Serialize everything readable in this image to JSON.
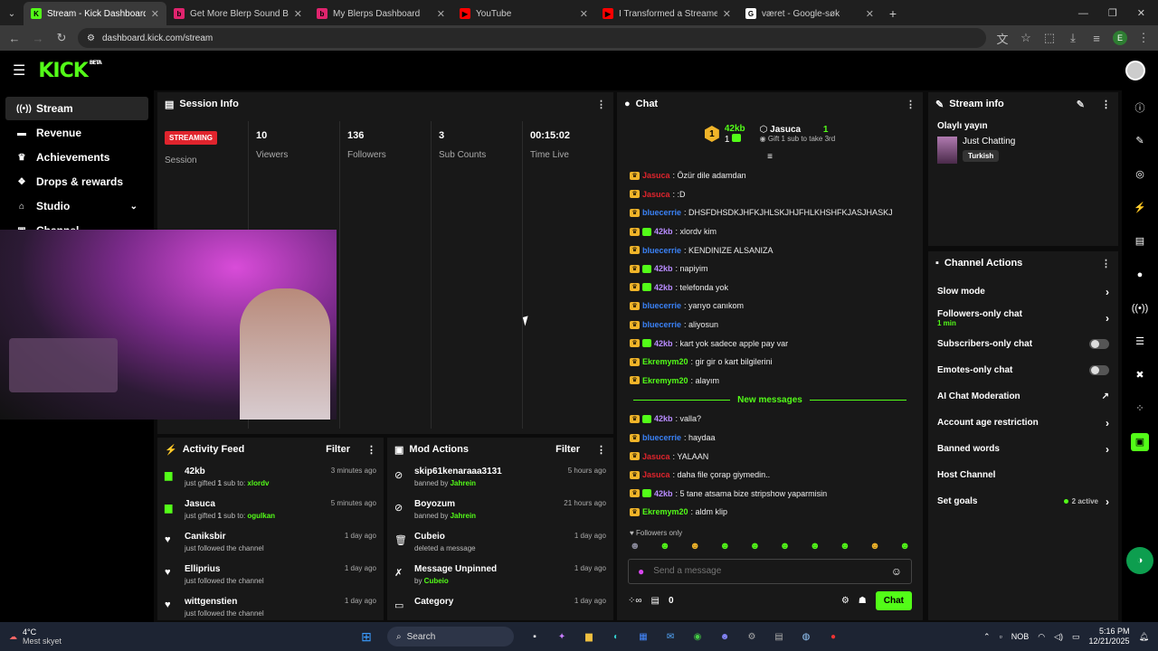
{
  "browser": {
    "tabs": [
      {
        "title": "Stream - Kick Dashboard",
        "color": "#53fc18",
        "glyph": "K"
      },
      {
        "title": "Get More Blerp Sound Beets!",
        "color": "#e0246e",
        "glyph": "b"
      },
      {
        "title": "My Blerps Dashboard",
        "color": "#e0246e",
        "glyph": "b"
      },
      {
        "title": "YouTube",
        "color": "#ff0000",
        "glyph": "▶"
      },
      {
        "title": "I Transformed a Streamer's Life",
        "color": "#ff0000",
        "glyph": "▶"
      },
      {
        "title": "været - Google-søk",
        "color": "#ffffff",
        "glyph": "G"
      }
    ],
    "url": "dashboard.kick.com/stream",
    "profile_initial": "E"
  },
  "brand": {
    "logo": "KICK",
    "beta": "BETA"
  },
  "sidebar": {
    "items": [
      {
        "label": "Stream",
        "icon": "broadcast-icon"
      },
      {
        "label": "Revenue",
        "icon": "revenue-icon"
      },
      {
        "label": "Achievements",
        "icon": "trophy-icon"
      },
      {
        "label": "Drops & rewards",
        "icon": "gift-icon"
      },
      {
        "label": "Studio",
        "icon": "studio-icon"
      },
      {
        "label": "Channel",
        "icon": "channel-icon"
      }
    ]
  },
  "session": {
    "title": "Session Info",
    "status": "STREAMING",
    "session_label": "Session",
    "stats": [
      {
        "value": "10",
        "label": "Viewers"
      },
      {
        "value": "136",
        "label": "Followers"
      },
      {
        "value": "3",
        "label": "Sub Counts"
      },
      {
        "value": "00:15:02",
        "label": "Time Live"
      }
    ]
  },
  "activity": {
    "title": "Activity Feed",
    "filter": "Filter",
    "items": [
      {
        "name": "42kb",
        "pre": "just gifted ",
        "count": "1",
        "mid": " sub to: ",
        "target": "xlordv",
        "time": "3 minutes ago",
        "icon": "gift-icon"
      },
      {
        "name": "Jasuca",
        "pre": "just gifted ",
        "count": "1",
        "mid": " sub to: ",
        "target": "ogulkan",
        "time": "5 minutes ago",
        "icon": "gift-icon"
      },
      {
        "name": "Caniksbir",
        "pre": "just followed the channel",
        "count": "",
        "mid": "",
        "target": "",
        "time": "1 day ago",
        "icon": "heart-icon"
      },
      {
        "name": "Elliprius",
        "pre": "just followed the channel",
        "count": "",
        "mid": "",
        "target": "",
        "time": "1 day ago",
        "icon": "heart-icon"
      },
      {
        "name": "wittgenstien",
        "pre": "just followed the channel",
        "count": "",
        "mid": "",
        "target": "",
        "time": "1 day ago",
        "icon": "heart-icon"
      }
    ]
  },
  "mod": {
    "title": "Mod Actions",
    "filter": "Filter",
    "items": [
      {
        "name": "skip61kenaraaa3131",
        "pre": "banned by ",
        "by": "Jahrein",
        "time": "5 hours ago",
        "icon": "ban-icon"
      },
      {
        "name": "Boyozum",
        "pre": "banned by ",
        "by": "Jahrein",
        "time": "21 hours ago",
        "icon": "ban-icon"
      },
      {
        "name": "Cubeio",
        "pre": "deleted a message",
        "by": "",
        "time": "1 day ago",
        "icon": "trash-icon"
      },
      {
        "name": "Message Unpinned",
        "pre": "by ",
        "by": "Cubeio",
        "time": "1 day ago",
        "icon": "unpin-icon"
      },
      {
        "name": "Category",
        "pre": "",
        "by": "",
        "time": "1 day ago",
        "icon": "category-icon"
      }
    ]
  },
  "chat": {
    "title": "Chat",
    "leader": {
      "rank": "1",
      "name1": "42kb",
      "count1": "1",
      "name2": "Jasuca",
      "count2": "1",
      "gift_text": "Gift 1 sub to take 3rd"
    },
    "messages": [
      {
        "user": "Jasuca",
        "cls": "u-red",
        "gift": false,
        "text": ": Özür dile adamdan"
      },
      {
        "user": "Jasuca",
        "cls": "u-red",
        "gift": false,
        "text": ": :D"
      },
      {
        "user": "bluecerrie",
        "cls": "u-blue",
        "gift": false,
        "text": ": DHSFDHSDKJHFKJHLSKJHJFHLKHSHFKJASJHASKJ"
      },
      {
        "user": "42kb",
        "cls": "u-purple",
        "gift": true,
        "text": ": xlordv kim"
      },
      {
        "user": "bluecerrie",
        "cls": "u-blue",
        "gift": false,
        "text": ": KENDINIZE ALSANIZA"
      },
      {
        "user": "42kb",
        "cls": "u-purple",
        "gift": true,
        "text": ": napiyim"
      },
      {
        "user": "42kb",
        "cls": "u-purple",
        "gift": true,
        "text": ": telefonda yok"
      },
      {
        "user": "bluecerrie",
        "cls": "u-blue",
        "gift": false,
        "text": ": yarıyo canıkom"
      },
      {
        "user": "bluecerrie",
        "cls": "u-blue",
        "gift": false,
        "text": ": aliyosun"
      },
      {
        "user": "42kb",
        "cls": "u-purple",
        "gift": true,
        "text": ": kart yok sadece apple pay var"
      },
      {
        "user": "Ekremym20",
        "cls": "u-green",
        "gift": false,
        "text": ": gir gir o kart bilgilerini"
      },
      {
        "user": "Ekremym20",
        "cls": "u-green",
        "gift": false,
        "text": ": alayım"
      }
    ],
    "new_label": "New messages",
    "new_messages": [
      {
        "user": "42kb",
        "cls": "u-purple",
        "gift": true,
        "text": ": valla?"
      },
      {
        "user": "bluecerrie",
        "cls": "u-blue",
        "gift": false,
        "text": ": haydaa"
      },
      {
        "user": "Jasuca",
        "cls": "u-red",
        "gift": false,
        "text": ": YALAAN"
      },
      {
        "user": "Jasuca",
        "cls": "u-red",
        "gift": false,
        "text": ": daha file çorap giymedin.."
      },
      {
        "user": "42kb",
        "cls": "u-purple",
        "gift": true,
        "text": ": 5 tane atsama bize stripshow yaparmisin"
      },
      {
        "user": "Ekremym20",
        "cls": "u-green",
        "gift": false,
        "text": ": aldm klip"
      }
    ],
    "followers_only": "Followers only",
    "placeholder": "Send a message",
    "points": "0",
    "send_label": "Chat"
  },
  "stream_info": {
    "title": "Stream info",
    "stream_title": "Olaylı yayın",
    "category": "Just Chatting",
    "tag": "Turkish"
  },
  "channel_actions": {
    "title": "Channel Actions",
    "rows": [
      {
        "label": "Slow mode",
        "sub": "",
        "control": "chevron"
      },
      {
        "label": "Followers-only chat",
        "sub": "1 min",
        "control": "chevron"
      },
      {
        "label": "Subscribers-only chat",
        "sub": "",
        "control": "toggle"
      },
      {
        "label": "Emotes-only chat",
        "sub": "",
        "control": "toggle"
      },
      {
        "label": "AI Chat Moderation",
        "sub": "",
        "control": "external"
      },
      {
        "label": "Account age restriction",
        "sub": "",
        "control": "chevron"
      },
      {
        "label": "Banned words",
        "sub": "",
        "control": "chevron"
      },
      {
        "label": "Host Channel",
        "sub": "",
        "control": "none"
      },
      {
        "label": "Set goals",
        "sub": "",
        "control": "goals",
        "status": "2 active"
      }
    ]
  },
  "taskbar": {
    "temp": "4°C",
    "weather": "Mest skyet",
    "search": "Search",
    "lang": "NOB",
    "time": "5:16 PM",
    "date": "12/21/2025"
  },
  "colors": {
    "accent": "#53fc18",
    "live": "#e0242d",
    "panel": "#181818"
  }
}
